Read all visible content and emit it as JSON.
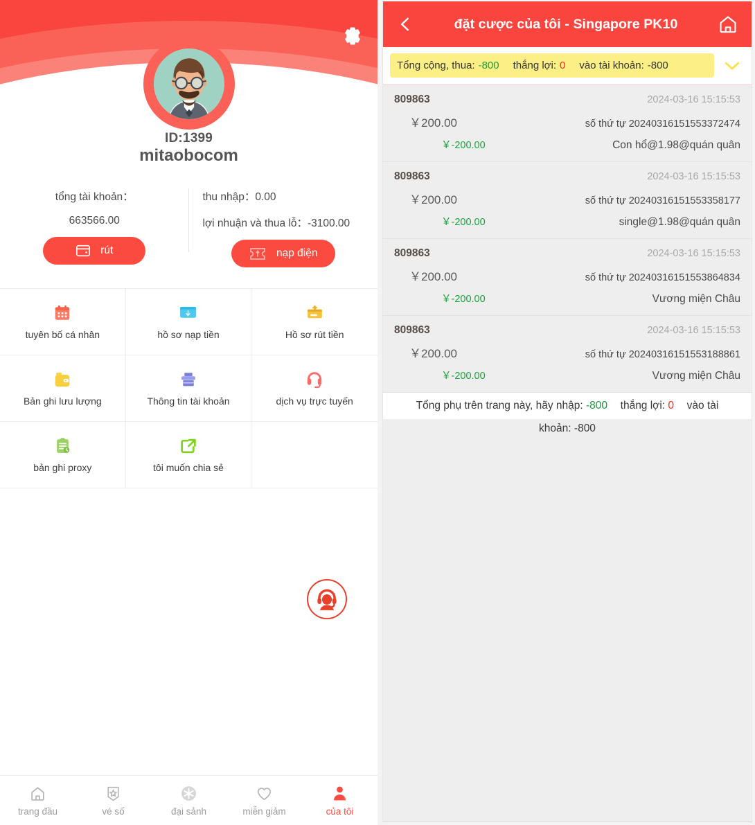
{
  "left": {
    "gear_icon": "gear-icon",
    "profile": {
      "id_label": "ID:1399",
      "username": "mitaobocom",
      "avatar_icon": "user-avatar"
    },
    "balance": {
      "total_label": "tổng tài khoản：",
      "total_value": "663566.00",
      "income_label": "thu nhập：",
      "income_value": "0.00",
      "pnl_label": "lợi nhuận và thua lỗ：",
      "pnl_value": "-3100.00",
      "withdraw_button": "rút",
      "deposit_button": "nạp điện"
    },
    "menu": [
      {
        "label": "tuyên bố cá nhân",
        "icon": "calendar-icon",
        "color": "#fa7a63"
      },
      {
        "label": "hồ sơ nạp tiền",
        "icon": "deposit-card-icon",
        "color": "#4ec8ef"
      },
      {
        "label": "Hồ sơ rút tiền",
        "icon": "withdraw-card-icon",
        "color": "#f6c43c"
      },
      {
        "label": "Bản ghi lưu lượng",
        "icon": "wallet-icon",
        "color": "#f8cf3e"
      },
      {
        "label": "Thông tin tài khoản",
        "icon": "bank-icon",
        "color": "#7b7fe0"
      },
      {
        "label": "dịch vụ trực tuyến",
        "icon": "headset-icon",
        "color": "#f96a68"
      },
      {
        "label": "bản ghi proxy",
        "icon": "clipboard-icon",
        "color": "#9bd165"
      },
      {
        "label": "tôi muốn chia sẻ",
        "icon": "share-icon",
        "color": "#7ed321"
      }
    ],
    "support_button_icon": "customer-service-icon",
    "tabs": [
      {
        "label": "trang đầu",
        "icon": "home-icon",
        "active": false
      },
      {
        "label": "vé số",
        "icon": "lottery-ticket-icon",
        "active": false
      },
      {
        "label": "đại sảnh",
        "icon": "lobby-icon",
        "active": false
      },
      {
        "label": "miễn giảm",
        "icon": "heart-icon",
        "active": false
      },
      {
        "label": "của tôi",
        "icon": "person-icon",
        "active": true
      }
    ]
  },
  "right": {
    "header": {
      "back_icon": "chevron-left-icon",
      "title": "đặt cược của tôi - Singapore PK10",
      "home_icon": "home-outline-icon"
    },
    "summary": {
      "total_label": "Tổng cộng, thua:",
      "total_value": "-800",
      "win_label": "thắng lợi:",
      "win_value": "0",
      "account_label": "vào tài khoản:",
      "account_value": "-800",
      "toggle_icon": "chevron-down-icon"
    },
    "bets": [
      {
        "id": "809863",
        "time": "2024-03-16 15:15:53",
        "amount": "￥200.00",
        "order": "số thứ tự 20240316151553372474",
        "profit": "￥-200.00",
        "desc": "Con hổ@1.98@quán quân"
      },
      {
        "id": "809863",
        "time": "2024-03-16 15:15:53",
        "amount": "￥200.00",
        "order": "số thứ tự 20240316151553358177",
        "profit": "￥-200.00",
        "desc": "single@1.98@quán quân"
      },
      {
        "id": "809863",
        "time": "2024-03-16 15:15:53",
        "amount": "￥200.00",
        "order": "số thứ tự 20240316151553864834",
        "profit": "￥-200.00",
        "desc": "Vương miện Châu"
      },
      {
        "id": "809863",
        "time": "2024-03-16 15:15:53",
        "amount": "￥200.00",
        "order": "số thứ tự 20240316151553188861",
        "profit": "￥-200.00",
        "desc": "Vương miện Châu"
      }
    ],
    "page_total": {
      "label": "Tổng phụ trên trang này, hãy nhập:",
      "value": "-800",
      "win_label": "thắng lợi:",
      "win_value": "0",
      "account_label_part1": "vào tài",
      "account_label_part2": "khoản:",
      "account_value": "-800"
    }
  },
  "colors": {
    "brand_red": "#f9453d",
    "accent_red": "#fb4b41",
    "banner_yellow": "#fbef85",
    "green": "#1d9a3d"
  }
}
